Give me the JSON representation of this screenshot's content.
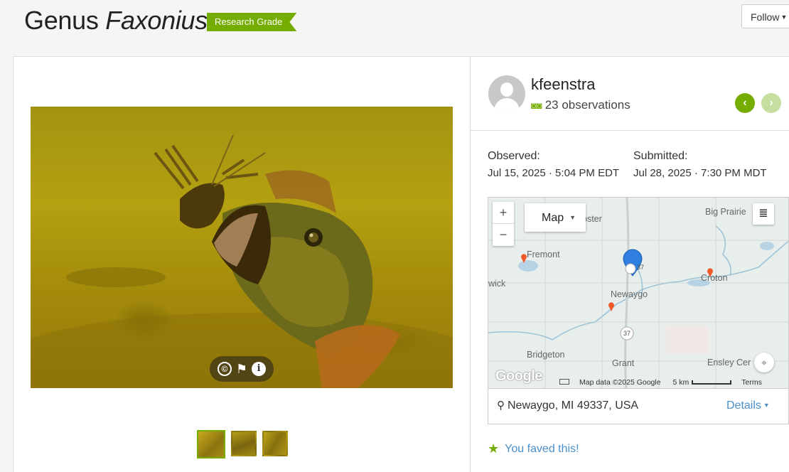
{
  "header": {
    "title_rank": "Genus",
    "title_name": "Faxonius",
    "quality_badge": "Research Grade",
    "follow_label": "Follow"
  },
  "colors": {
    "accent_green": "#74ac00",
    "link_blue": "#4a8fc9"
  },
  "user": {
    "username": "kfeenstra",
    "observations": "23 observations",
    "prev_icon": "chevron-left-icon",
    "next_icon": "chevron-right-icon"
  },
  "observed": {
    "label": "Observed:",
    "value": "Jul 15, 2025 · 5:04 PM EDT"
  },
  "submitted": {
    "label": "Submitted:",
    "value": "Jul 28, 2025 · 7:30 PM MDT"
  },
  "map": {
    "type_label": "Map",
    "zoom_in": "+",
    "zoom_out": "−",
    "labels": [
      "Big Prairie",
      "Fremont",
      "Newaygo",
      "Croton",
      "Bridgeton",
      "Grant",
      "Ensley Cer",
      "wick",
      "oster"
    ],
    "route_labels": [
      "37",
      "37"
    ],
    "attribution": "Map data ©2025 Google",
    "scale_label": "5 km",
    "terms": "Terms",
    "google_logo": "Google"
  },
  "location": {
    "place": "Newaygo, MI 49337, USA",
    "details_label": "Details"
  },
  "fave": {
    "label": "You faved this!"
  }
}
